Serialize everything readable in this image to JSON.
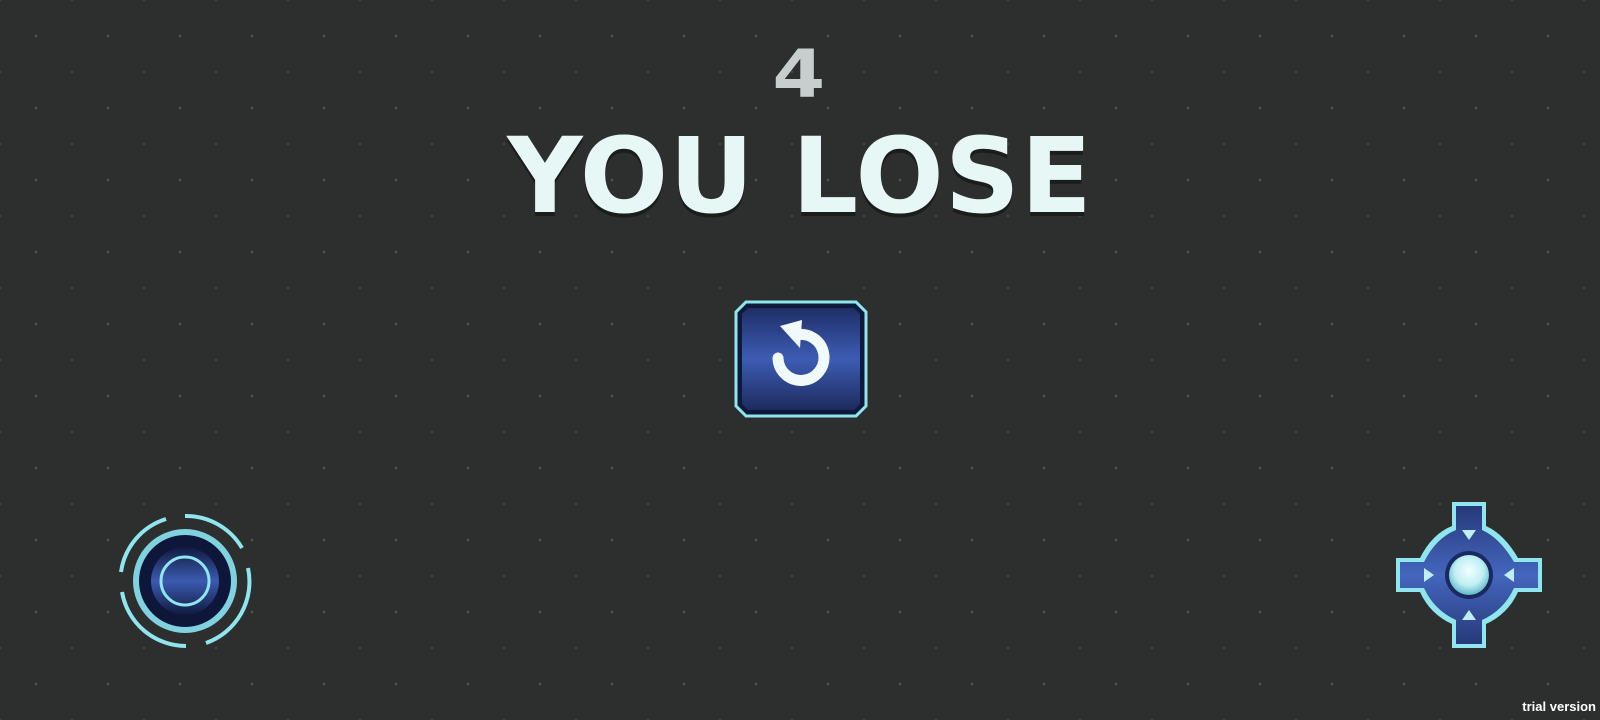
{
  "hud": {
    "score": "4",
    "title": "YOU LOSE"
  },
  "controls": {
    "restart_icon": "restart-arrow-icon",
    "fire_icon": "fire-ring-button-icon",
    "dpad_icon": "directional-pad-icon"
  },
  "watermark": {
    "text": "trial version"
  },
  "colors": {
    "background": "#2d2f2f",
    "title": "#e6f7f6",
    "score": "#c8cdcd",
    "button_blue": "#2f4c9a",
    "button_edge": "#8fe6ee"
  }
}
